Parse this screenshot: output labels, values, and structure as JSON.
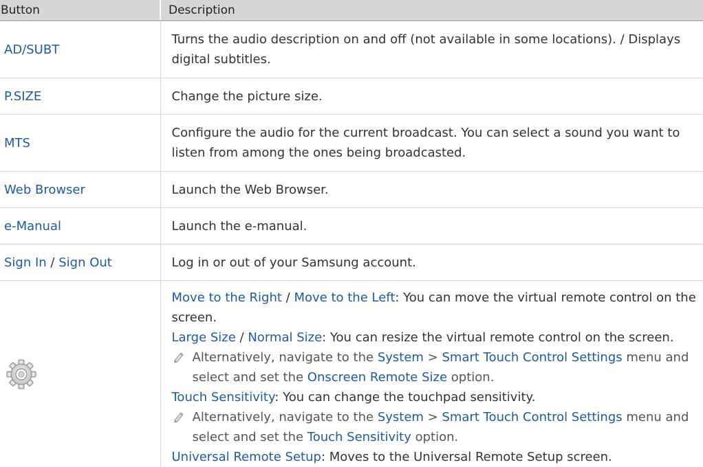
{
  "header": {
    "col1": "Button",
    "col2": "Description"
  },
  "rows": [
    {
      "button": "AD/SUBT",
      "desc": "Turns the audio description on and off (not available in some locations). / Displays digital subtitles."
    },
    {
      "button": "P.SIZE",
      "desc": "Change the picture size."
    },
    {
      "button": "MTS",
      "desc": "Configure the audio for the current broadcast. You can select a sound you want to listen from among the ones being broadcasted."
    },
    {
      "button": "Web Browser",
      "desc": "Launch the Web Browser."
    },
    {
      "button": "e-Manual",
      "desc": "Launch the e-manual."
    },
    {
      "button_a": "Sign In",
      "button_sep": " / ",
      "button_b": "Sign Out",
      "desc": "Log in or out of your Samsung account."
    }
  ],
  "settings": {
    "icon": "gear-icon",
    "move_right": "Move to the Right",
    "move_left": "Move to the Left",
    "move_desc": ": You can move the virtual remote control on the screen.",
    "large": "Large Size",
    "normal": "Normal Size",
    "size_desc": ": You can resize the virtual remote control on the screen.",
    "note_pre": "Alternatively, navigate to the ",
    "note_system": "System",
    "note_chevron": " > ",
    "note_stcs": "Smart Touch Control Settings",
    "note_mid": " menu and select and set the ",
    "note1_option": "Onscreen Remote Size",
    "note_post": " option.",
    "touch": "Touch Sensitivity",
    "touch_desc": ": You can change the touchpad sensitivity.",
    "note2_option": "Touch Sensitivity",
    "universal": "Universal Remote Setup",
    "universal_desc": ": Moves to the Universal Remote Setup screen."
  },
  "colors": {
    "accent": "#1f5aa6",
    "header_bg": "#d6d6d6",
    "text": "#333333"
  }
}
